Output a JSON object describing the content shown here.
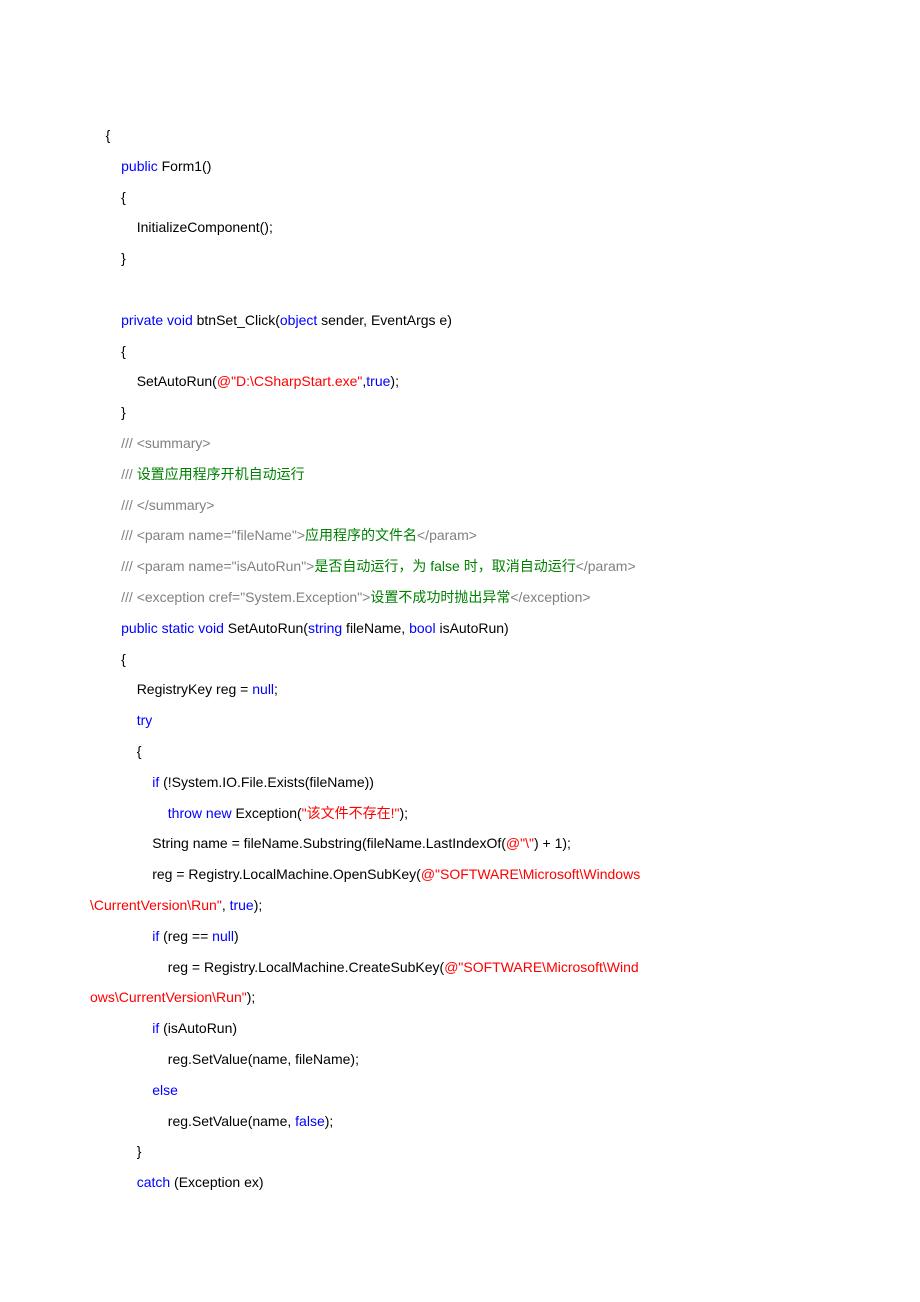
{
  "lines": [
    {
      "indent": "    ",
      "tokens": [
        {
          "text": "{",
          "cls": ""
        }
      ]
    },
    {
      "indent": "        ",
      "tokens": [
        {
          "text": "public",
          "cls": "kw-blue"
        },
        {
          "text": " Form1()",
          "cls": ""
        }
      ]
    },
    {
      "indent": "        ",
      "tokens": [
        {
          "text": "{",
          "cls": ""
        }
      ]
    },
    {
      "indent": "            ",
      "tokens": [
        {
          "text": "InitializeComponent();",
          "cls": ""
        }
      ]
    },
    {
      "indent": "        ",
      "tokens": [
        {
          "text": "}",
          "cls": ""
        }
      ]
    },
    {
      "indent": "",
      "tokens": [
        {
          "text": " ",
          "cls": ""
        }
      ]
    },
    {
      "indent": "        ",
      "tokens": [
        {
          "text": "private",
          "cls": "kw-blue"
        },
        {
          "text": " ",
          "cls": ""
        },
        {
          "text": "void",
          "cls": "kw-blue"
        },
        {
          "text": " btnSet_Click(",
          "cls": ""
        },
        {
          "text": "object",
          "cls": "kw-blue"
        },
        {
          "text": " sender, EventArgs e)",
          "cls": ""
        }
      ]
    },
    {
      "indent": "        ",
      "tokens": [
        {
          "text": "{",
          "cls": ""
        }
      ]
    },
    {
      "indent": "            ",
      "tokens": [
        {
          "text": "SetAutoRun(",
          "cls": ""
        },
        {
          "text": "@\"D:\\CSharpStart.exe\"",
          "cls": "str-red"
        },
        {
          "text": ",",
          "cls": ""
        },
        {
          "text": "true",
          "cls": "kw-blue"
        },
        {
          "text": ");",
          "cls": ""
        }
      ]
    },
    {
      "indent": "        ",
      "tokens": [
        {
          "text": "}",
          "cls": ""
        }
      ]
    },
    {
      "indent": "        ",
      "tokens": [
        {
          "text": "/// ",
          "cls": "comment-gray"
        },
        {
          "text": "<summary>",
          "cls": "comment-gray"
        }
      ]
    },
    {
      "indent": "        ",
      "tokens": [
        {
          "text": "/// ",
          "cls": "comment-gray"
        },
        {
          "text": "设置应用程序开机自动运行",
          "cls": "comment-green"
        }
      ]
    },
    {
      "indent": "        ",
      "tokens": [
        {
          "text": "/// ",
          "cls": "comment-gray"
        },
        {
          "text": "</summary>",
          "cls": "comment-gray"
        }
      ]
    },
    {
      "indent": "        ",
      "tokens": [
        {
          "text": "/// ",
          "cls": "comment-gray"
        },
        {
          "text": "<param name=\"fileName\">",
          "cls": "comment-gray"
        },
        {
          "text": "应用程序的文件名",
          "cls": "comment-green"
        },
        {
          "text": "</param>",
          "cls": "comment-gray"
        }
      ]
    },
    {
      "indent": "        ",
      "tokens": [
        {
          "text": "/// ",
          "cls": "comment-gray"
        },
        {
          "text": "<param name=\"isAutoRun\">",
          "cls": "comment-gray"
        },
        {
          "text": "是否自动运行，为 ",
          "cls": "comment-green"
        },
        {
          "text": "false ",
          "cls": "comment-green"
        },
        {
          "text": "时，取消自动运行",
          "cls": "comment-green"
        },
        {
          "text": "</param>",
          "cls": "comment-gray"
        }
      ]
    },
    {
      "indent": "        ",
      "tokens": [
        {
          "text": "/// ",
          "cls": "comment-gray"
        },
        {
          "text": "<exception cref=\"System.Exception\">",
          "cls": "comment-gray"
        },
        {
          "text": "设置不成功时抛出异常",
          "cls": "comment-green"
        },
        {
          "text": "</exception>",
          "cls": "comment-gray"
        }
      ]
    },
    {
      "indent": "        ",
      "tokens": [
        {
          "text": "public",
          "cls": "kw-blue"
        },
        {
          "text": " ",
          "cls": ""
        },
        {
          "text": "static",
          "cls": "kw-blue"
        },
        {
          "text": " ",
          "cls": ""
        },
        {
          "text": "void",
          "cls": "kw-blue"
        },
        {
          "text": " SetAutoRun(",
          "cls": ""
        },
        {
          "text": "string",
          "cls": "kw-blue"
        },
        {
          "text": " fileName, ",
          "cls": ""
        },
        {
          "text": "bool",
          "cls": "kw-blue"
        },
        {
          "text": " isAutoRun)",
          "cls": ""
        }
      ]
    },
    {
      "indent": "        ",
      "tokens": [
        {
          "text": "{",
          "cls": ""
        }
      ]
    },
    {
      "indent": "            ",
      "tokens": [
        {
          "text": "RegistryKey reg = ",
          "cls": ""
        },
        {
          "text": "null",
          "cls": "kw-blue"
        },
        {
          "text": ";",
          "cls": ""
        }
      ]
    },
    {
      "indent": "            ",
      "tokens": [
        {
          "text": "try",
          "cls": "kw-blue"
        }
      ]
    },
    {
      "indent": "            ",
      "tokens": [
        {
          "text": "{",
          "cls": ""
        }
      ]
    },
    {
      "indent": "                ",
      "tokens": [
        {
          "text": "if",
          "cls": "kw-blue"
        },
        {
          "text": " (!System.IO.File.Exists(fileName))",
          "cls": ""
        }
      ]
    },
    {
      "indent": "                    ",
      "tokens": [
        {
          "text": "throw",
          "cls": "kw-blue"
        },
        {
          "text": " ",
          "cls": ""
        },
        {
          "text": "new",
          "cls": "kw-blue"
        },
        {
          "text": " Exception(",
          "cls": ""
        },
        {
          "text": "\"该文件不存在!\"",
          "cls": "str-red"
        },
        {
          "text": ");",
          "cls": ""
        }
      ]
    },
    {
      "indent": "                ",
      "tokens": [
        {
          "text": "String name = fileName.Substring(fileName.LastIndexOf(",
          "cls": ""
        },
        {
          "text": "@\"\\\"",
          "cls": "str-red"
        },
        {
          "text": ") + 1);",
          "cls": ""
        }
      ]
    },
    {
      "indent": "                ",
      "tokens": [
        {
          "text": "reg = Registry.LocalMachine.OpenSubKey(",
          "cls": ""
        },
        {
          "text": "@\"SOFTWARE\\Microsoft\\Windows",
          "cls": "str-red"
        }
      ]
    },
    {
      "indent": "",
      "tokens": [
        {
          "text": "\\CurrentVersion\\Run\"",
          "cls": "str-red"
        },
        {
          "text": ", ",
          "cls": ""
        },
        {
          "text": "true",
          "cls": "kw-blue"
        },
        {
          "text": ");",
          "cls": ""
        }
      ]
    },
    {
      "indent": "                ",
      "tokens": [
        {
          "text": "if",
          "cls": "kw-blue"
        },
        {
          "text": " (reg == ",
          "cls": ""
        },
        {
          "text": "null",
          "cls": "kw-blue"
        },
        {
          "text": ")",
          "cls": ""
        }
      ]
    },
    {
      "indent": "                    ",
      "tokens": [
        {
          "text": "reg = Registry.LocalMachine.CreateSubKey(",
          "cls": ""
        },
        {
          "text": "@\"SOFTWARE\\Microsoft\\Wind",
          "cls": "str-red"
        }
      ]
    },
    {
      "indent": "",
      "tokens": [
        {
          "text": "ows\\CurrentVersion\\Run\"",
          "cls": "str-red"
        },
        {
          "text": ");",
          "cls": ""
        }
      ]
    },
    {
      "indent": "                ",
      "tokens": [
        {
          "text": "if",
          "cls": "kw-blue"
        },
        {
          "text": " (isAutoRun)",
          "cls": ""
        }
      ]
    },
    {
      "indent": "                    ",
      "tokens": [
        {
          "text": "reg.SetValue(name, fileName);",
          "cls": ""
        }
      ]
    },
    {
      "indent": "                ",
      "tokens": [
        {
          "text": "else",
          "cls": "kw-blue"
        }
      ]
    },
    {
      "indent": "                    ",
      "tokens": [
        {
          "text": "reg.SetValue(name, ",
          "cls": ""
        },
        {
          "text": "false",
          "cls": "kw-blue"
        },
        {
          "text": ");",
          "cls": ""
        }
      ]
    },
    {
      "indent": "            ",
      "tokens": [
        {
          "text": "}",
          "cls": ""
        }
      ]
    },
    {
      "indent": "            ",
      "tokens": [
        {
          "text": "catch",
          "cls": "kw-blue"
        },
        {
          "text": " (Exception ex)",
          "cls": ""
        }
      ]
    }
  ]
}
